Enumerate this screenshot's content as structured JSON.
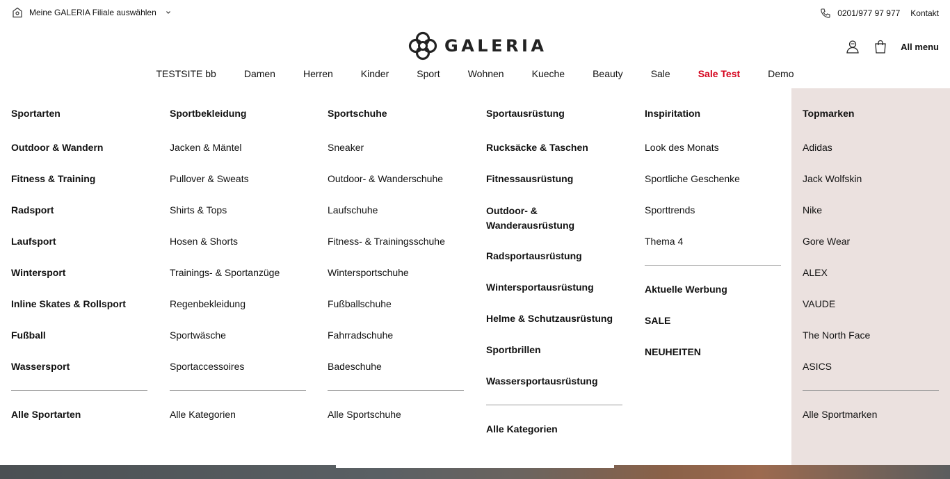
{
  "topbar": {
    "store_label": "Meine GALERIA Filiale auswählen",
    "phone": "0201/977 97 977",
    "contact": "Kontakt"
  },
  "logo": {
    "text": "GALERIA"
  },
  "header": {
    "all_menu": "All menu"
  },
  "nav": {
    "items": [
      {
        "label": "TESTSITE bb"
      },
      {
        "label": "Damen"
      },
      {
        "label": "Herren"
      },
      {
        "label": "Kinder"
      },
      {
        "label": "Sport"
      },
      {
        "label": "Wohnen"
      },
      {
        "label": "Kueche"
      },
      {
        "label": "Beauty"
      },
      {
        "label": "Sale"
      },
      {
        "label": "Sale Test"
      },
      {
        "label": "Demo"
      }
    ],
    "highlight_color": "#d4001a"
  },
  "flyout": {
    "sportarten": {
      "title": "Sportarten",
      "items": [
        "Outdoor & Wandern",
        "Fitness & Training",
        "Radsport",
        "Laufsport",
        "Wintersport",
        "Inline Skates & Rollsport",
        "Fußball",
        "Wassersport"
      ],
      "all": "Alle Sportarten"
    },
    "bekleidung": {
      "title": "Sportbekleidung",
      "items": [
        "Jacken & Mäntel",
        "Pullover & Sweats",
        "Shirts & Tops",
        "Hosen & Shorts",
        "Trainings- & Sportanzüge",
        "Regenbekleidung",
        "Sportwäsche",
        "Sportaccessoires"
      ],
      "all": "Alle Kategorien"
    },
    "schuhe": {
      "title": "Sportschuhe",
      "items": [
        "Sneaker",
        "Outdoor- & Wanderschuhe",
        "Laufschuhe",
        "Fitness- & Trainingsschuhe",
        "Wintersportschuhe",
        "Fußballschuhe",
        "Fahrradschuhe",
        "Badeschuhe"
      ],
      "all": "Alle Sportschuhe"
    },
    "ausruestung": {
      "title": "Sportausrüstung",
      "items": [
        "Rucksäcke & Taschen",
        "Fitnessausrüstung",
        "Outdoor- & Wanderausrüstung",
        "Radsportausrüstung",
        "Wintersportausrüstung",
        "Helme & Schutzausrüstung",
        "Sportbrillen",
        "Wassersportausrüstung"
      ],
      "all": "Alle Kategorien"
    },
    "inspiration": {
      "title": "Inspiritation",
      "items": [
        "Look des Monats",
        "Sportliche Geschenke",
        "Sporttrends",
        "Thema 4"
      ],
      "extras": [
        "Aktuelle Werbung",
        "SALE",
        "NEUHEITEN"
      ]
    },
    "topmarken": {
      "title": "Topmarken",
      "items": [
        "Adidas",
        "Jack Wolfskin",
        "Nike",
        "Gore Wear",
        "ALEX",
        "VAUDE",
        "The North Face",
        "ASICS"
      ],
      "all": "Alle Sportmarken",
      "bg_color": "#ebe1df"
    }
  }
}
